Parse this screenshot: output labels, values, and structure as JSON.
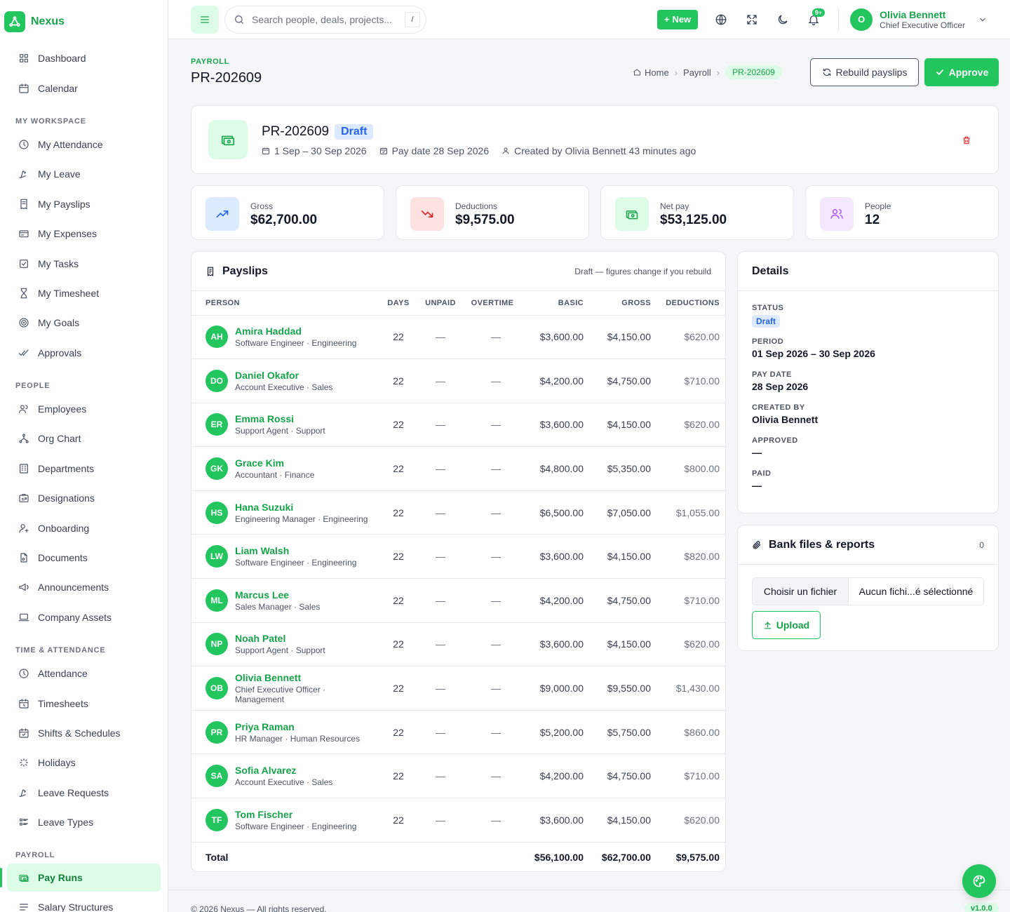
{
  "brand": {
    "name": "Nexus"
  },
  "sidebar": {
    "top": [
      {
        "label": "Dashboard",
        "icon": "dashboard-icon"
      },
      {
        "label": "Calendar",
        "icon": "calendar-icon"
      }
    ],
    "sections": [
      {
        "title": "My Workspace",
        "items": [
          "My Attendance",
          "My Leave",
          "My Payslips",
          "My Expenses",
          "My Tasks",
          "My Timesheet",
          "My Goals",
          "Approvals"
        ]
      },
      {
        "title": "People",
        "items": [
          "Employees",
          "Org Chart",
          "Departments",
          "Designations",
          "Onboarding",
          "Documents",
          "Announcements",
          "Company Assets"
        ]
      },
      {
        "title": "Time & Attendance",
        "items": [
          "Attendance",
          "Timesheets",
          "Shifts & Schedules",
          "Holidays",
          "Leave Requests",
          "Leave Types"
        ]
      },
      {
        "title": "Payroll",
        "items": [
          "Pay Runs",
          "Salary Structures"
        ]
      }
    ],
    "active": "Pay Runs"
  },
  "topbar": {
    "search_placeholder": "Search people, deals, projects...",
    "search_shortcut": "/",
    "new_label": "New",
    "notif_badge": "9+",
    "user_initial": "O",
    "user_name": "Olivia Bennett",
    "user_role": "Chief Executive Officer"
  },
  "page": {
    "eyebrow": "PAYROLL",
    "title": "PR-202609",
    "breadcrumb": [
      "Home",
      "Payroll",
      "PR-202609"
    ],
    "rebuild_label": "Rebuild payslips",
    "approve_label": "Approve"
  },
  "summary": {
    "title": "PR-202609",
    "status": "Draft",
    "period": "1 Sep – 30 Sep 2026",
    "pay_date": "Pay date 28 Sep 2026",
    "created": "Created by Olivia Bennett 43 minutes ago"
  },
  "stats": [
    {
      "label": "Gross",
      "value": "$62,700.00",
      "color": "#2563eb",
      "bg": "#dbeafe"
    },
    {
      "label": "Deductions",
      "value": "$9,575.00",
      "color": "#dc2626",
      "bg": "#fee2e2"
    },
    {
      "label": "Net pay",
      "value": "$53,125.00",
      "color": "#16a34a",
      "bg": "#dcfce7"
    },
    {
      "label": "People",
      "value": "12",
      "color": "#a855f7",
      "bg": "#f3e8ff"
    }
  ],
  "payslips": {
    "title": "Payslips",
    "note": "Draft — figures change if you rebuild",
    "columns": [
      "Person",
      "Days",
      "Unpaid",
      "Overtime",
      "Basic",
      "Gross",
      "Deductions"
    ],
    "rows": [
      {
        "initials": "AH",
        "name": "Amira Haddad",
        "role": "Software Engineer · Engineering",
        "days": "22",
        "unpaid": "—",
        "overtime": "—",
        "basic": "$3,600.00",
        "gross": "$4,150.00",
        "deductions": "$620.00"
      },
      {
        "initials": "DO",
        "name": "Daniel Okafor",
        "role": "Account Executive · Sales",
        "days": "22",
        "unpaid": "—",
        "overtime": "—",
        "basic": "$4,200.00",
        "gross": "$4,750.00",
        "deductions": "$710.00"
      },
      {
        "initials": "ER",
        "name": "Emma Rossi",
        "role": "Support Agent · Support",
        "days": "22",
        "unpaid": "—",
        "overtime": "—",
        "basic": "$3,600.00",
        "gross": "$4,150.00",
        "deductions": "$620.00"
      },
      {
        "initials": "GK",
        "name": "Grace Kim",
        "role": "Accountant · Finance",
        "days": "22",
        "unpaid": "—",
        "overtime": "—",
        "basic": "$4,800.00",
        "gross": "$5,350.00",
        "deductions": "$800.00"
      },
      {
        "initials": "HS",
        "name": "Hana Suzuki",
        "role": "Engineering Manager · Engineering",
        "days": "22",
        "unpaid": "—",
        "overtime": "—",
        "basic": "$6,500.00",
        "gross": "$7,050.00",
        "deductions": "$1,055.00"
      },
      {
        "initials": "LW",
        "name": "Liam Walsh",
        "role": "Software Engineer · Engineering",
        "days": "22",
        "unpaid": "—",
        "overtime": "—",
        "basic": "$3,600.00",
        "gross": "$4,150.00",
        "deductions": "$820.00"
      },
      {
        "initials": "ML",
        "name": "Marcus Lee",
        "role": "Sales Manager · Sales",
        "days": "22",
        "unpaid": "—",
        "overtime": "—",
        "basic": "$4,200.00",
        "gross": "$4,750.00",
        "deductions": "$710.00"
      },
      {
        "initials": "NP",
        "name": "Noah Patel",
        "role": "Support Agent · Support",
        "days": "22",
        "unpaid": "—",
        "overtime": "—",
        "basic": "$3,600.00",
        "gross": "$4,150.00",
        "deductions": "$620.00"
      },
      {
        "initials": "OB",
        "name": "Olivia Bennett",
        "role": "Chief Executive Officer · Management",
        "days": "22",
        "unpaid": "—",
        "overtime": "—",
        "basic": "$9,000.00",
        "gross": "$9,550.00",
        "deductions": "$1,430.00"
      },
      {
        "initials": "PR",
        "name": "Priya Raman",
        "role": "HR Manager · Human Resources",
        "days": "22",
        "unpaid": "—",
        "overtime": "—",
        "basic": "$5,200.00",
        "gross": "$5,750.00",
        "deductions": "$860.00"
      },
      {
        "initials": "SA",
        "name": "Sofia Alvarez",
        "role": "Account Executive · Sales",
        "days": "22",
        "unpaid": "—",
        "overtime": "—",
        "basic": "$4,200.00",
        "gross": "$4,750.00",
        "deductions": "$710.00"
      },
      {
        "initials": "TF",
        "name": "Tom Fischer",
        "role": "Software Engineer · Engineering",
        "days": "22",
        "unpaid": "—",
        "overtime": "—",
        "basic": "$3,600.00",
        "gross": "$4,150.00",
        "deductions": "$620.00"
      }
    ],
    "total": {
      "label": "Total",
      "basic": "$56,100.00",
      "gross": "$62,700.00",
      "deductions": "$9,575.00"
    }
  },
  "details": {
    "title": "Details",
    "status_label": "Status",
    "status": "Draft",
    "period_label": "Period",
    "period": "01 Sep 2026 – 30 Sep 2026",
    "paydate_label": "Pay date",
    "paydate": "28 Sep 2026",
    "createdby_label": "Created by",
    "createdby": "Olivia Bennett",
    "approved_label": "Approved",
    "approved": "—",
    "paid_label": "Paid",
    "paid": "—"
  },
  "bankfiles": {
    "title": "Bank files & reports",
    "count": "0",
    "choose_label": "Choisir un fichier",
    "no_file": "Aucun fichi...é sélectionné",
    "upload_label": "Upload"
  },
  "footer": {
    "copyright": "© 2026 Nexus — All rights reserved.",
    "version": "v1.0.0"
  }
}
